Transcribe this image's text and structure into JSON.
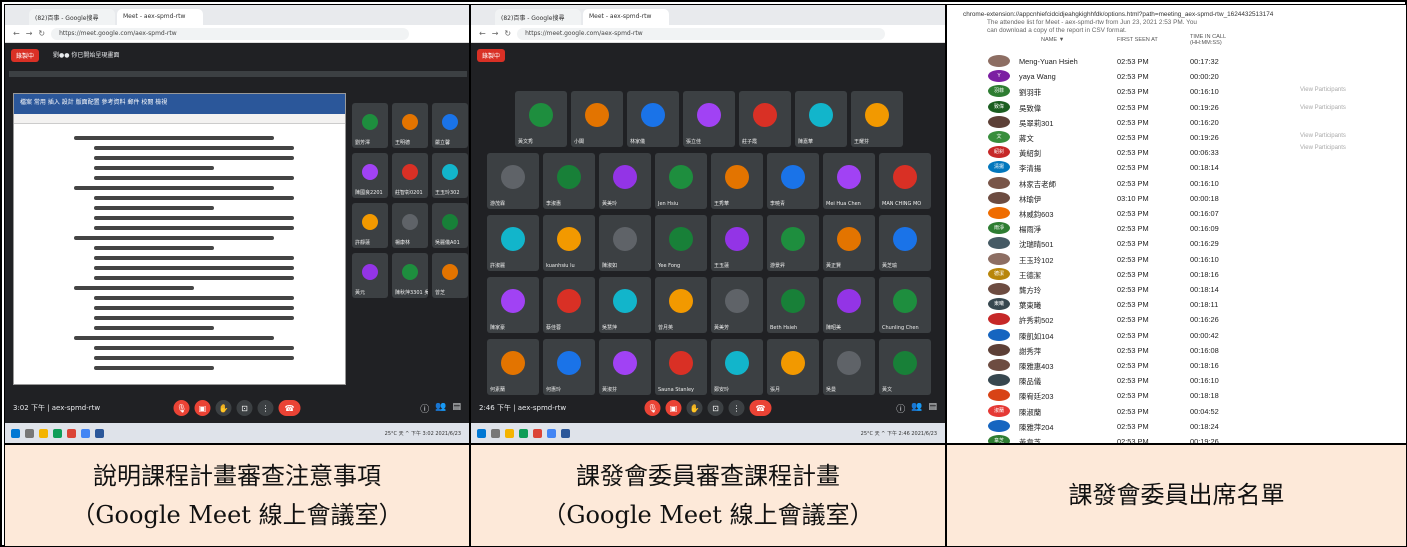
{
  "captions": {
    "cell1_line1": "說明課程計畫審查注意事項",
    "cell1_line2": "（Google Meet 線上會議室）",
    "cell2_line1": "課發會委員審查課程計畫",
    "cell2_line2": "（Google Meet 線上會議室）",
    "cell3_line1": "課發會委員出席名單"
  },
  "screen1": {
    "tabs": [
      "(82)百事 - Google搜尋",
      "Meet - aex-spmd-rtw"
    ],
    "url": "https://meet.google.com/aex-spmd-rtw",
    "recording": "錄製中",
    "banner": "劉●● 你已開始呈現畫面",
    "meeting_info": "3:02 下午  |  aex-spmd-rtw",
    "taskbar_text": "25°C 天 ^ 下午 3:02 2021/6/23",
    "participants": [
      "劉芳澤",
      "王明德",
      "嚴立馨",
      "陳國良2201",
      "莊智彰0201",
      "王玉玲302",
      "許靜蓮",
      "楊康林",
      "吳麗儀A01",
      "黃元",
      "陳秋萍3301 吳佳惠",
      "曾芝"
    ]
  },
  "screen2": {
    "tabs": [
      "(82)百事 - Google搜尋",
      "Meet - aex-spmd-rtw"
    ],
    "url": "https://meet.google.com/aex-spmd-rtw",
    "recording": "錄製中",
    "meeting_info": "2:46 下午  |  aex-spmd-rtw",
    "taskbar_text": "25°C 天 ^ 下午 2:46 2021/6/23",
    "participants": [
      "黃文秀",
      "小閣",
      "林家儀",
      "張立佳",
      "莊子霞",
      "陳嘉華",
      "王耀芬",
      "游茂霖",
      "李淑惠",
      "黃美玲",
      "Jen Hsiu",
      "王秀華",
      "李曉青",
      "Mei Hua Chen",
      "MAN CHING MO",
      "許淑麗",
      "kuanhsiu lu",
      "陳淑如",
      "Yee Fong",
      "王玉蓮",
      "游景昇",
      "黃正賢",
      "黃芝瑜",
      "陳家豪",
      "蔡佳蓉",
      "吳慧萍",
      "曾月英",
      "黃美芳",
      "Beth Hsieh",
      "陳昭美",
      "Chunling Chen",
      "何素蘭",
      "何惠玲",
      "黃淑芬",
      "Sauna Stanley",
      "鄭安玲",
      "張月",
      "吳曼",
      "黃文"
    ]
  },
  "attendees": {
    "url": "chrome-extension://appcnhiefcidcidjeahgkighhfdk/options.html?path=meeting_aex-spmd-rtw_1624432513174",
    "desc": "The attendee list for Meet - aex-spmd-rtw from Jun 23, 2021 2:53 PM. You can download a copy of the report in CSV format.",
    "col_name": "NAME ▼",
    "col_first": "FIRST SEEN AT",
    "col_time_1": "TIME IN CALL",
    "col_time_2": "(HH:MM:SS)",
    "view_participants": "View Participants",
    "rows": [
      {
        "name": "Meng-Yuan Hsieh",
        "first": "02:53 PM",
        "time": "00:17:32",
        "av": "",
        "color": "#8d6e63"
      },
      {
        "name": "yaya Wang",
        "first": "02:53 PM",
        "time": "00:00:20",
        "av": "Y",
        "color": "#7b1fa2"
      },
      {
        "name": "劉羽菲",
        "first": "02:53 PM",
        "time": "00:16:10",
        "av": "羽菲",
        "color": "#2e7d32"
      },
      {
        "name": "吳致偉",
        "first": "02:53 PM",
        "time": "00:19:26",
        "av": "致偉",
        "color": "#1b5e20"
      },
      {
        "name": "吳翠莉301",
        "first": "02:53 PM",
        "time": "00:16:20",
        "av": "",
        "color": "#5d4037"
      },
      {
        "name": "蔣文",
        "first": "02:53 PM",
        "time": "00:19:26",
        "av": "文",
        "color": "#388e3c"
      },
      {
        "name": "黃紹釗",
        "first": "02:53 PM",
        "time": "00:06:33",
        "av": "紹釗",
        "color": "#c62828"
      },
      {
        "name": "李清揚",
        "first": "02:53 PM",
        "time": "00:18:14",
        "av": "清揚",
        "color": "#0277bd"
      },
      {
        "name": "林家吉老師",
        "first": "02:53 PM",
        "time": "00:16:10",
        "av": "",
        "color": "#795548"
      },
      {
        "name": "林瑜伊",
        "first": "03:10 PM",
        "time": "00:00:18",
        "av": "",
        "color": "#6d4c41"
      },
      {
        "name": "林威鈞603",
        "first": "02:53 PM",
        "time": "00:16:07",
        "av": "",
        "color": "#ef6c00"
      },
      {
        "name": "楊雨淨",
        "first": "02:53 PM",
        "time": "00:16:09",
        "av": "雨淨",
        "color": "#2e7d32"
      },
      {
        "name": "沈瑞晴501",
        "first": "02:53 PM",
        "time": "00:16:29",
        "av": "",
        "color": "#455a64"
      },
      {
        "name": "王玉玲102",
        "first": "02:53 PM",
        "time": "00:16:10",
        "av": "",
        "color": "#8d6e63"
      },
      {
        "name": "王德潔",
        "first": "02:53 PM",
        "time": "00:18:16",
        "av": "德潔",
        "color": "#b8860b"
      },
      {
        "name": "龔方玲",
        "first": "02:53 PM",
        "time": "00:18:14",
        "av": "",
        "color": "#6d4c41"
      },
      {
        "name": "葉東曦",
        "first": "02:53 PM",
        "time": "00:18:11",
        "av": "東曦",
        "color": "#37474f"
      },
      {
        "name": "許秀莉502",
        "first": "02:53 PM",
        "time": "00:16:26",
        "av": "",
        "color": "#c62828"
      },
      {
        "name": "陳凱如104",
        "first": "02:53 PM",
        "time": "00:00:42",
        "av": "",
        "color": "#1565c0"
      },
      {
        "name": "謝秀萍",
        "first": "02:53 PM",
        "time": "00:16:08",
        "av": "",
        "color": "#5d4037"
      },
      {
        "name": "陳雅惠403",
        "first": "02:53 PM",
        "time": "00:18:16",
        "av": "",
        "color": "#6d4c41"
      },
      {
        "name": "陳品儀",
        "first": "02:53 PM",
        "time": "00:16:10",
        "av": "",
        "color": "#37474f"
      },
      {
        "name": "陳宥廷203",
        "first": "02:53 PM",
        "time": "00:18:18",
        "av": "",
        "color": "#d84315"
      },
      {
        "name": "陳淑蘭",
        "first": "02:53 PM",
        "time": "00:04:52",
        "av": "淑蘭",
        "color": "#e53935"
      },
      {
        "name": "陳雅萍204",
        "first": "02:53 PM",
        "time": "00:18:24",
        "av": "",
        "color": "#1565c0"
      },
      {
        "name": "黃韋芝",
        "first": "02:53 PM",
        "time": "00:19:26",
        "av": "韋芝",
        "color": "#2e7d32"
      }
    ]
  }
}
